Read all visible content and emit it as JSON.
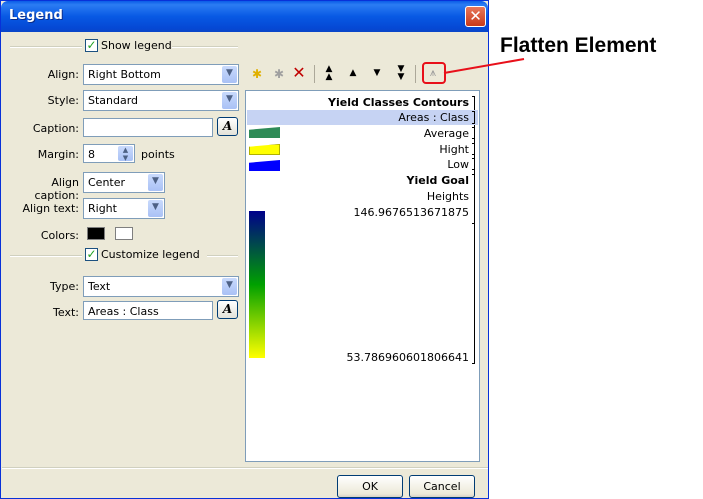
{
  "window": {
    "title": "Legend"
  },
  "show_legend": {
    "label": "Show legend",
    "checked": true
  },
  "form": {
    "align_label": "Align:",
    "align_value": "Right Bottom",
    "style_label": "Style:",
    "style_value": "Standard",
    "caption_label": "Caption:",
    "caption_value": "",
    "margin_label": "Margin:",
    "margin_value": "8",
    "margin_unit": "points",
    "align_caption_label": "Align caption:",
    "align_caption_value": "Center",
    "align_text_label": "Align text:",
    "align_text_value": "Right",
    "colors_label": "Colors:",
    "color1": "#000000",
    "color2": "#ffffff",
    "format_button_glyph": "A"
  },
  "customize_legend": {
    "label": "Customize legend",
    "checked": true
  },
  "custom": {
    "type_label": "Type:",
    "type_value": "Text",
    "text_label": "Text:",
    "text_value": "Areas : Class"
  },
  "toolbar": {
    "icons": [
      "add-element-icon",
      "add-sub-element-icon",
      "delete-icon",
      "move-top-icon",
      "move-up-icon",
      "move-down-icon",
      "move-bottom-icon",
      "flatten-element-icon"
    ]
  },
  "preview": {
    "heading": "Yield Classes Contours",
    "selected_item": "Areas : Class",
    "classes": [
      {
        "label": "Average",
        "color": "#2e8b57"
      },
      {
        "label": "Hight",
        "color": "#ffff00"
      },
      {
        "label": "Low",
        "color": "#0000ff"
      }
    ],
    "goal_heading": "Yield Goal",
    "goal_subheading": "Heights",
    "max_value": "146.9676513671875",
    "min_value": "53.786960601806641",
    "gradient_colors": [
      "#00008b",
      "#00c000",
      "#ffff00"
    ]
  },
  "buttons": {
    "ok": "OK",
    "cancel": "Cancel"
  },
  "callout": {
    "text": "Flatten Element",
    "color": "#e8101a"
  }
}
